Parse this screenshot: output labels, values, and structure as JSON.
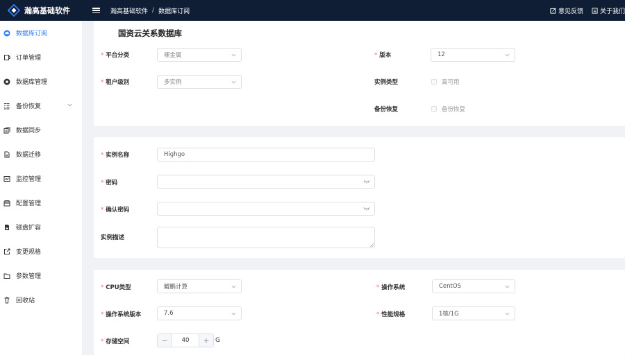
{
  "header": {
    "app_name": "瀚高基础软件",
    "breadcrumb": [
      "瀚高基础软件",
      "数据库订阅"
    ],
    "breadcrumb_sep": "/",
    "links": [
      {
        "label": "意见反馈",
        "icon": "edit-icon"
      },
      {
        "label": "关于我们",
        "icon": "info-icon"
      }
    ]
  },
  "sidebar": {
    "items": [
      {
        "label": "数据库订阅",
        "icon": "cloud-icon",
        "active": true
      },
      {
        "label": "订单管理",
        "icon": "order-icon"
      },
      {
        "label": "数据库管理",
        "icon": "database-icon"
      },
      {
        "label": "备份恢复",
        "icon": "backup-icon",
        "expandable": true
      },
      {
        "label": "数据同步",
        "icon": "sync-icon"
      },
      {
        "label": "数据迁移",
        "icon": "migrate-icon"
      },
      {
        "label": "监控管理",
        "icon": "monitor-icon"
      },
      {
        "label": "配置管理",
        "icon": "config-icon"
      },
      {
        "label": "磁盘扩容",
        "icon": "disk-icon"
      },
      {
        "label": "变更规格",
        "icon": "resize-icon"
      },
      {
        "label": "参数管理",
        "icon": "folder-icon"
      },
      {
        "label": "回收站",
        "icon": "trash-icon"
      }
    ]
  },
  "section1": {
    "title": "国资云关系数据库",
    "platform": {
      "label": "平台分类",
      "value": "裸金属"
    },
    "tenant": {
      "label": "租户级别",
      "value": "多实例"
    },
    "version": {
      "label": "版本",
      "value": "12"
    },
    "instance_type": {
      "label": "实例类型",
      "option": "高可用"
    },
    "backup": {
      "label": "备份恢复",
      "option": "备份恢复"
    }
  },
  "section2": {
    "name": {
      "label": "实例名称",
      "value": "Highgo"
    },
    "password": {
      "label": "密码",
      "value": ""
    },
    "confirm_password": {
      "label": "确认密码",
      "value": ""
    },
    "description": {
      "label": "实例描述",
      "value": ""
    }
  },
  "section3": {
    "cpu": {
      "label": "CPU类型",
      "value": "鲲鹏计算"
    },
    "os": {
      "label": "操作系统",
      "value": "CentOS"
    },
    "os_version": {
      "label": "操作系统版本",
      "value": "7.6"
    },
    "spec": {
      "label": "性能规格",
      "value": "1核/1G"
    },
    "storage": {
      "label": "存储空间",
      "value": "40",
      "minus": "−",
      "plus": "+",
      "unit": "G"
    }
  },
  "colors": {
    "header_bg": "#0f1e35",
    "accent": "#2f7df6",
    "required": "#f56c6c"
  }
}
